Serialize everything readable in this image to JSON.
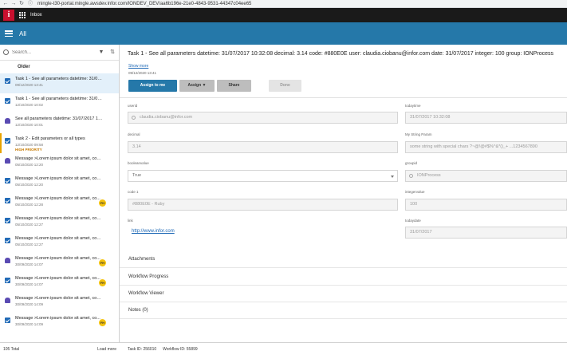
{
  "browser": {
    "back": "←",
    "forward": "→",
    "reload": "↻",
    "lock": "ⓘ",
    "url": "mingle-t30-portal.mingle.awsdev.infor.com/IONDEV_DEV/aa6b196e-21e0-4843-9531-44347c04ee65"
  },
  "appbar": {
    "logo": "i",
    "app_name": "Inbox"
  },
  "header": {
    "title": "All"
  },
  "sidebar": {
    "search_placeholder": "Search...",
    "filter_icon": "▼",
    "sort_icon": "⇅",
    "group_label": "Older",
    "items": [
      {
        "title": "Task 1 - See all parameters datetime: 31/07/2017 10:32:08 decimal",
        "date": "09/12/2020 13:41",
        "icon": "check-icon",
        "selected": true
      },
      {
        "title": "Task 1 - See all parameters datetime: 31/07/2017",
        "date": "12/10/2020 10:02",
        "icon": "check-icon"
      },
      {
        "title": "See all parameters datetime: 31/07/2017 10:32:08",
        "date": "12/10/2020 10:01",
        "icon": "bell-icon"
      },
      {
        "title": "Task 2 - Edit parameters or all types",
        "date": "12/10/2020 09:58",
        "icon": "check-icon",
        "priority": "HIGH PRIORITY"
      },
      {
        "title": "Message >Lorem ipsum dolor sit amet, consectetur",
        "date": "05/10/2020 12:20",
        "icon": "bell-icon"
      },
      {
        "title": "Message >Lorem ipsum dolor sit amet, consectetur",
        "date": "05/10/2020 12:20",
        "icon": "check-icon"
      },
      {
        "title": "Message >Lorem ipsum dolor sit amet, co...",
        "date": "05/10/2020 12:28",
        "icon": "check-icon",
        "badge": "FH"
      },
      {
        "title": "Message >Lorem ipsum dolor sit amet, consectetur",
        "date": "05/10/2020 12:27",
        "icon": "check-icon"
      },
      {
        "title": "Message >Lorem ipsum dolor sit amet, consectetur",
        "date": "05/10/2020 12:27",
        "icon": "check-icon"
      },
      {
        "title": "Message >Lorem ipsum dolor sit amet, co...",
        "date": "30/09/2020 14:07",
        "icon": "bell-icon",
        "badge": "FH"
      },
      {
        "title": "Message >Lorem ipsum dolor sit amet, co...",
        "date": "30/09/2020 14:07",
        "icon": "check-icon",
        "badge": "FH"
      },
      {
        "title": "Message >Lorem ipsum dolor sit amet, consectetur",
        "date": "30/09/2020 14:09",
        "icon": "bell-icon"
      },
      {
        "title": "Message >Lorem ipsum dolor sit amet, co...",
        "date": "30/09/2020 14:09",
        "icon": "check-icon",
        "badge": "FH"
      }
    ],
    "total": "105 Total",
    "load_more": "Load more"
  },
  "task": {
    "title": "Task 1 - See all parameters datetime: 31/07/2017 10:32:08 decimal: 3.14 code: #880E0E user: claudia.ciobanu@infor.com date: 31/07/2017 integer: 100 group: IONProcess",
    "show_more": "Show more",
    "date": "09/12/2020 13:41",
    "buttons": {
      "assign_to_me": "Assign to me",
      "assign": "Assign ▼",
      "share": "Share",
      "done": "Done"
    },
    "fields": {
      "userid_label": "userid",
      "userid_value": "claudia.ciobanu@infor.com",
      "todaytime_label": "todaytime",
      "todaytime_value": "31/07/2017 10:32:08",
      "decimal_label": "decimal",
      "decimal_value": "3.14",
      "string_label": "My String Param",
      "string_value": "some string with special chars ?~@!@#$%^&*()_+ ...1234567890",
      "boolean_label": "booleanvalue",
      "boolean_value": "True",
      "groupid_label": "groupid",
      "groupid_value": "IONProcess",
      "code_label": "code 1",
      "code_value": "#880E0E - Ruby",
      "integer_label": "integervalue",
      "integer_value": "100",
      "link_label": "link",
      "link_value": "http://www.infor.com",
      "todaydate_label": "todaydate",
      "todaydate_value": "31/07/2017"
    },
    "sections": {
      "attachments": "Attachments",
      "workflow_progress": "Workflow Progress",
      "workflow_viewer": "Workflow Viewer",
      "notes": "Notes (0)"
    },
    "footer": {
      "task_id": "Task ID: 256010",
      "workflow_id": "Workflow ID: 55899"
    }
  }
}
